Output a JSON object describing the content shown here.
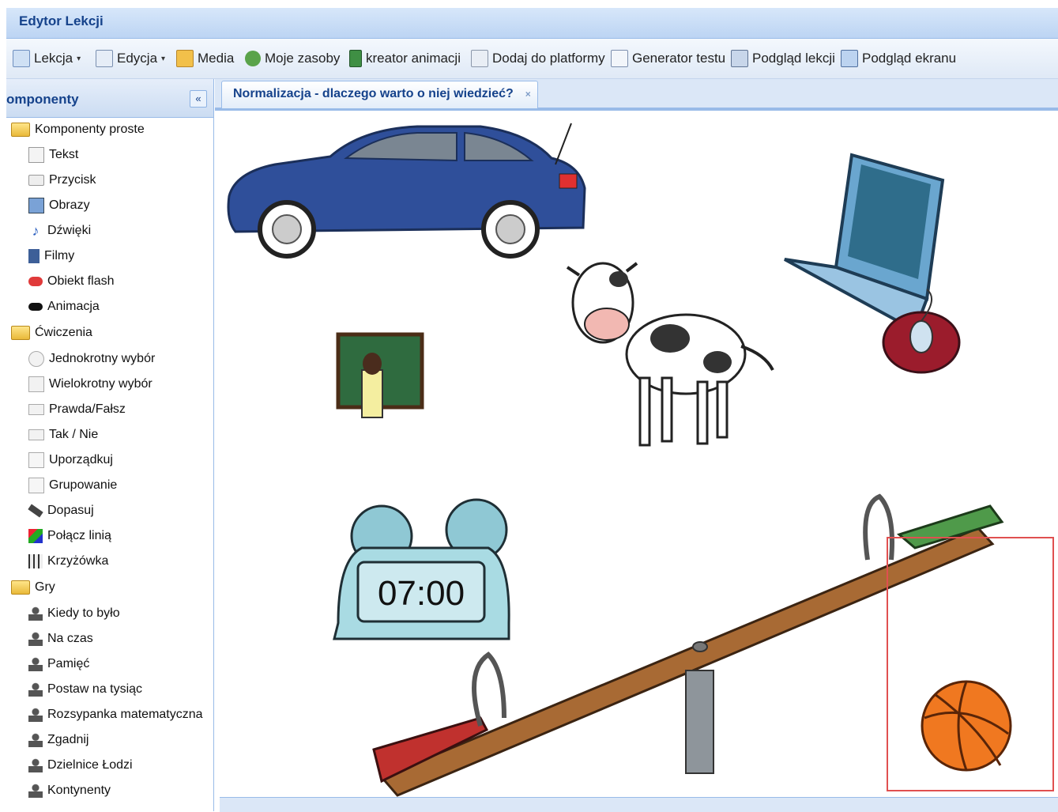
{
  "window": {
    "title": "Edytor Lekcji"
  },
  "toolbar": {
    "items": [
      {
        "label": "Lekcja",
        "has_menu": true,
        "icon": "lesson-icon"
      },
      {
        "label": "Edycja",
        "has_menu": true,
        "icon": "edit-icon"
      },
      {
        "label": "Media",
        "has_menu": false,
        "icon": "media-icon"
      },
      {
        "label": "Moje zasoby",
        "has_menu": false,
        "icon": "resources-icon"
      },
      {
        "label": "kreator animacji",
        "has_menu": false,
        "icon": "film-icon"
      },
      {
        "label": "Dodaj do platformy",
        "has_menu": false,
        "icon": "platform-icon"
      },
      {
        "label": "Generator testu",
        "has_menu": false,
        "icon": "test-icon"
      },
      {
        "label": "Podgląd lekcji",
        "has_menu": false,
        "icon": "preview-icon"
      },
      {
        "label": "Podgląd ekranu",
        "has_menu": false,
        "icon": "screen-icon"
      }
    ],
    "menu_arrow": "▾"
  },
  "sidebar": {
    "title": "omponenty",
    "collapse": "«",
    "groups": [
      {
        "label": "Komponenty proste",
        "items": [
          "Tekst",
          "Przycisk",
          "Obrazy",
          "Dźwięki",
          "Filmy",
          "Obiekt flash",
          "Animacja"
        ]
      },
      {
        "label": "Ćwiczenia",
        "items": [
          "Jednokrotny wybór",
          "Wielokrotny wybór",
          "Prawda/Fałsz",
          "Tak / Nie",
          "Uporządkuj",
          "Grupowanie",
          "Dopasuj",
          "Połącz linią",
          "Krzyżówka"
        ]
      },
      {
        "label": "Gry",
        "items": [
          "Kiedy to było",
          "Na czas",
          "Pamięć",
          "Postaw na tysiąc",
          "Rozsypanka matematyczna",
          "Zgadnij",
          "Dzielnice Łodzi",
          "Kontynenty"
        ]
      }
    ]
  },
  "document": {
    "tab_title": "Normalizacja - dlaczego warto o niej wiedzieć?",
    "tab_close": "×",
    "clock_time": "07:00"
  },
  "colors": {
    "title_text": "#15428b",
    "car": "#2f4f9a",
    "laptop": "#6aa6cf",
    "selection": "#e05050",
    "seesaw": "#a86a34",
    "ball": "#f07820"
  }
}
